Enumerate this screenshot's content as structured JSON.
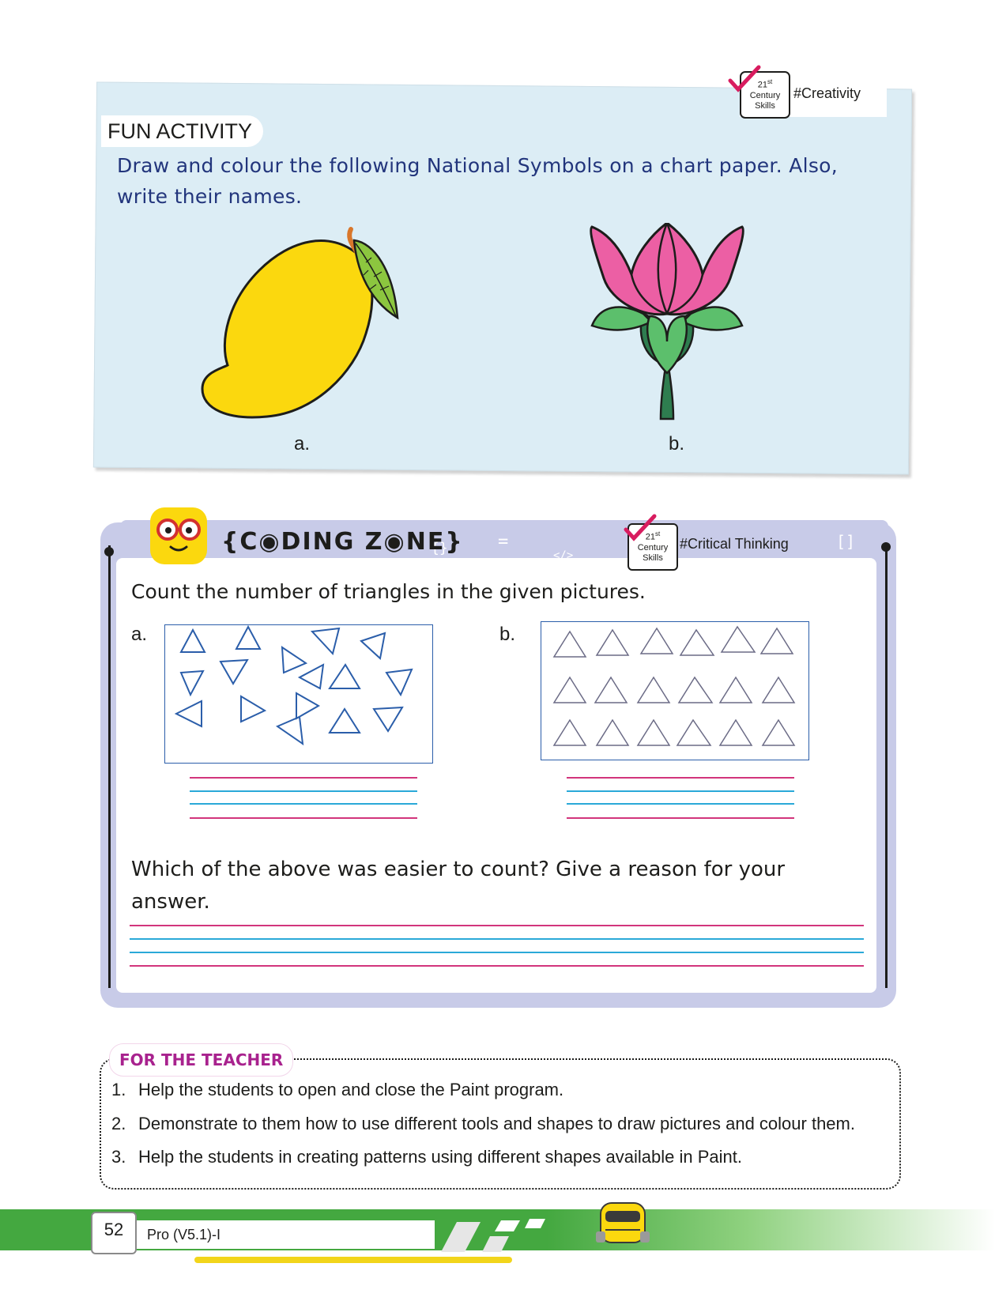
{
  "fun_activity": {
    "heading": "FUN ACTIVITY",
    "badge": {
      "sup": "st",
      "num": "21",
      "line2": "Century",
      "line3": "Skills",
      "tag": "#Creativity"
    },
    "instruction": "Draw and colour the following National Symbols on a chart paper. Also, write their names.",
    "labels": [
      "a.",
      "b."
    ],
    "icons": [
      "mango-icon",
      "lotus-icon"
    ]
  },
  "coding_zone": {
    "title": "{C◉DING Z◉NE}",
    "badge": {
      "sup": "st",
      "num": "21",
      "line2": "Century",
      "line3": "Skills",
      "tag": "#Critical Thinking"
    },
    "question1": "Count the number of triangles in the given pictures.",
    "labels": [
      "a.",
      "b."
    ],
    "question2": "Which of the above was easier to count? Give a reason for your answer."
  },
  "teacher": {
    "heading": "FOR THE TEACHER",
    "items": [
      {
        "num": "1.",
        "text": "Help the students to open and close the Paint program."
      },
      {
        "num": "2.",
        "text": "Demonstrate to them how to use different tools and shapes to draw pictures and colour them."
      },
      {
        "num": "3.",
        "text": "Help the students in creating patterns using different shapes available in Paint."
      }
    ]
  },
  "footer": {
    "page_number": "52",
    "book_title": "Pro (V5.1)-I"
  },
  "colors": {
    "card_bg": "#dcedf5",
    "instruction_text": "#22357c",
    "coding_zone_frame": "#c8cbe8",
    "pink_rule": "#d2357c",
    "blue_rule": "#2aa9d8",
    "teacher_heading": "#a8228e",
    "footer_green": "#44a840"
  }
}
